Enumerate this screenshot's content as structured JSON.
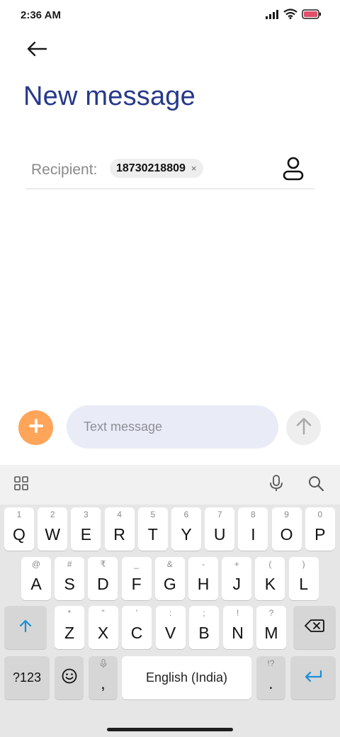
{
  "status_bar": {
    "time": "2:36 AM",
    "icons": [
      "signal-icon",
      "wifi-icon",
      "battery-icon"
    ],
    "battery_color": "#e0506a"
  },
  "header": {
    "back_icon": "arrow-left-icon",
    "title": "New message",
    "title_color": "#26398b"
  },
  "recipient": {
    "label": "Recipient:",
    "chip_number": "18730218809",
    "chip_remove": "×",
    "contact_icon": "person-icon"
  },
  "compose": {
    "placeholder": "Text message",
    "attach_icon": "plus-icon",
    "attach_color": "#ffa55a",
    "send_icon": "arrow-up-icon"
  },
  "keyboard": {
    "toolbar": {
      "left_icon": "grid-icon",
      "mic_icon": "mic-icon",
      "search_icon": "search-icon"
    },
    "row1": [
      {
        "k": "Q",
        "h": "1"
      },
      {
        "k": "W",
        "h": "2"
      },
      {
        "k": "E",
        "h": "3"
      },
      {
        "k": "R",
        "h": "4"
      },
      {
        "k": "T",
        "h": "5"
      },
      {
        "k": "Y",
        "h": "6"
      },
      {
        "k": "U",
        "h": "7"
      },
      {
        "k": "I",
        "h": "8"
      },
      {
        "k": "O",
        "h": "9"
      },
      {
        "k": "P",
        "h": "0"
      }
    ],
    "row2": [
      {
        "k": "A",
        "h": "@"
      },
      {
        "k": "S",
        "h": "#"
      },
      {
        "k": "D",
        "h": "₹"
      },
      {
        "k": "F",
        "h": "_"
      },
      {
        "k": "G",
        "h": "&"
      },
      {
        "k": "H",
        "h": "-"
      },
      {
        "k": "J",
        "h": "+"
      },
      {
        "k": "K",
        "h": "("
      },
      {
        "k": "L",
        "h": ")"
      }
    ],
    "row3": [
      {
        "k": "Z",
        "h": "*"
      },
      {
        "k": "X",
        "h": "\""
      },
      {
        "k": "C",
        "h": "'"
      },
      {
        "k": "V",
        "h": ":"
      },
      {
        "k": "B",
        "h": ";"
      },
      {
        "k": "N",
        "h": "!"
      },
      {
        "k": "M",
        "h": "?"
      }
    ],
    "shift_icon": "shift-arrow-icon",
    "backspace_icon": "backspace-icon",
    "symbols_label": "?123",
    "emoji_icon": "emoji-icon",
    "comma_label": ",",
    "comma_hint_icon": "mic-icon",
    "space_label": "English (India)",
    "period_label": ".",
    "period_hint": "!?",
    "enter_icon": "enter-icon",
    "enter_color": "#1a8fd6"
  }
}
